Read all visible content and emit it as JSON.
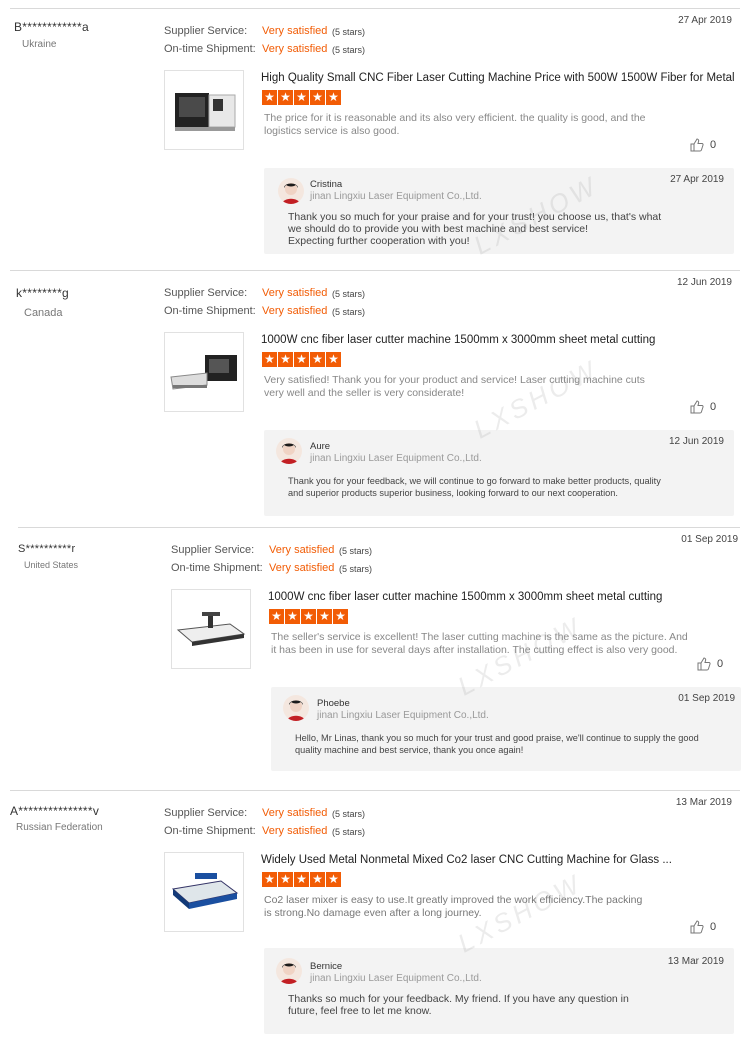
{
  "labels": {
    "supplier_service": "Supplier Service:",
    "ontime_shipment": "On-time Shipment:"
  },
  "watermark": "LXSHOW",
  "reviews": [
    {
      "buyer": "B************a",
      "country": "Ukraine",
      "supplier_value": "Very satisfied",
      "supplier_stars": "(5 stars)",
      "shipment_value": "Very satisfied",
      "shipment_stars": "(5 stars)",
      "date": "27 Apr 2019",
      "product": "High Quality Small CNC Fiber Laser Cutting Machine Price with 500W 1500W Fiber for Metal",
      "rating": 5,
      "text_lines": [
        "The price for it is reasonable and its also very efficient. the quality is good, and the",
        "logistics service is also good."
      ],
      "likes": "0",
      "reply": {
        "name": "Cristina",
        "company": "jinan Lingxiu Laser Equipment Co.,Ltd.",
        "date": "27 Apr 2019",
        "lines": [
          "Thank you so much for your praise and for your trust! you choose us, that's what",
          "we should do to  provide you with best machine and best service!",
          "Expecting further cooperation with you!"
        ]
      }
    },
    {
      "buyer": "k********g",
      "country": "Canada",
      "supplier_value": "Very satisfied",
      "supplier_stars": "(5 stars)",
      "shipment_value": "Very satisfied",
      "shipment_stars": "(5 stars)",
      "date": "12 Jun 2019",
      "product": "1000W cnc fiber laser cutter machine 1500mm x 3000mm sheet metal cutting",
      "rating": 5,
      "text_lines": [
        "Very satisfied! Thank you for your product and service! Laser cutting machine cuts",
        "very well and the seller is very considerate!"
      ],
      "likes": "0",
      "reply": {
        "name": "Aure",
        "company": "jinan Lingxiu Laser Equipment Co.,Ltd.",
        "date": "12 Jun 2019",
        "lines": [
          "Thank you for your feedback, we will continue to go forward to make better products, quality",
          "and superior products superior business, looking forward to our next cooperation."
        ]
      }
    },
    {
      "buyer": "S**********r",
      "country": "United States",
      "supplier_value": "Very satisfied",
      "supplier_stars": "(5 stars)",
      "shipment_value": "Very satisfied",
      "shipment_stars": "(5 stars)",
      "date": "01 Sep 2019",
      "product": "1000W cnc fiber laser cutter machine 1500mm x 3000mm sheet metal cutting",
      "rating": 5,
      "text_lines": [
        "The seller's service is excellent! The laser cutting machine is the same as the picture. And",
        "it has been in use for several days after installation. The cutting effect is also very good."
      ],
      "likes": "0",
      "reply": {
        "name": "Phoebe",
        "company": "jinan Lingxiu Laser Equipment Co.,Ltd.",
        "date": "01 Sep 2019",
        "lines": [
          "Hello, Mr Linas, thank you so much for your trust and good praise, we'll continue to supply the good",
          "quality machine and best service, thank you once again!"
        ]
      }
    },
    {
      "buyer": "A***************v",
      "country": "Russian Federation",
      "supplier_value": "Very satisfied",
      "supplier_stars": "(5 stars)",
      "shipment_value": "Very satisfied",
      "shipment_stars": "(5 stars)",
      "date": "13 Mar 2019",
      "product": "Widely Used Metal Nonmetal Mixed Co2 laser CNC Cutting Machine for Glass ...",
      "rating": 5,
      "text_lines": [
        "Co2 laser mixer is easy to use.It greatly improved the work efficiency.The packing",
        " is strong.No damage even after a long journey."
      ],
      "likes": "0",
      "reply": {
        "name": "Bernice",
        "company": "jinan Lingxiu Laser Equipment Co.,Ltd.",
        "date": "13 Mar 2019",
        "lines": [
          "Thanks so much for your feedback. My friend. If you have any question in",
          " future, feel free to let me know."
        ]
      }
    }
  ]
}
